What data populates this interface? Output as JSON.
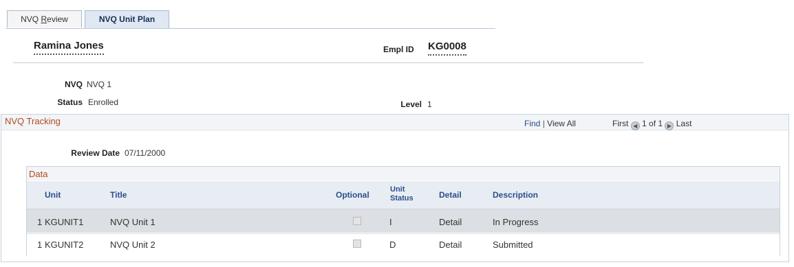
{
  "tabs": [
    {
      "label_pre": "NVQ ",
      "label_ul": "R",
      "label_post": "eview"
    },
    {
      "label": "NVQ Unit Plan"
    }
  ],
  "header": {
    "name": "Ramina Jones",
    "empl_id_label": "Empl ID",
    "empl_id": "KG0008"
  },
  "details": {
    "nvq_label": "NVQ",
    "nvq_value": "NVQ 1",
    "status_label": "Status",
    "status_value": "Enrolled",
    "level_label": "Level",
    "level_value": "1"
  },
  "tracking": {
    "title": "NVQ Tracking",
    "find": "Find",
    "divider": "|",
    "view_all": "View All",
    "first": "First",
    "count": "1 of 1",
    "last": "Last",
    "review_date_label": "Review Date",
    "review_date": "07/11/2000"
  },
  "grid": {
    "title": "Data",
    "columns": {
      "unit": "Unit",
      "title": "Title",
      "optional": "Optional",
      "unit_status_1": "Unit",
      "unit_status_2": "Status",
      "detail": "Detail",
      "description": "Description"
    },
    "rows": [
      {
        "num": "1",
        "unit": "KGUNIT1",
        "title": "NVQ Unit 1",
        "optional": false,
        "status": "I",
        "detail": "Detail",
        "description": "In Progress"
      },
      {
        "num": "1",
        "unit": "KGUNIT2",
        "title": "NVQ Unit 2",
        "optional": false,
        "status": "D",
        "detail": "Detail",
        "description": "Submitted"
      }
    ]
  },
  "colors": {
    "section_title": "#b44a1c",
    "link": "#2a4e8a",
    "active_tab": "#dfe8f3"
  }
}
